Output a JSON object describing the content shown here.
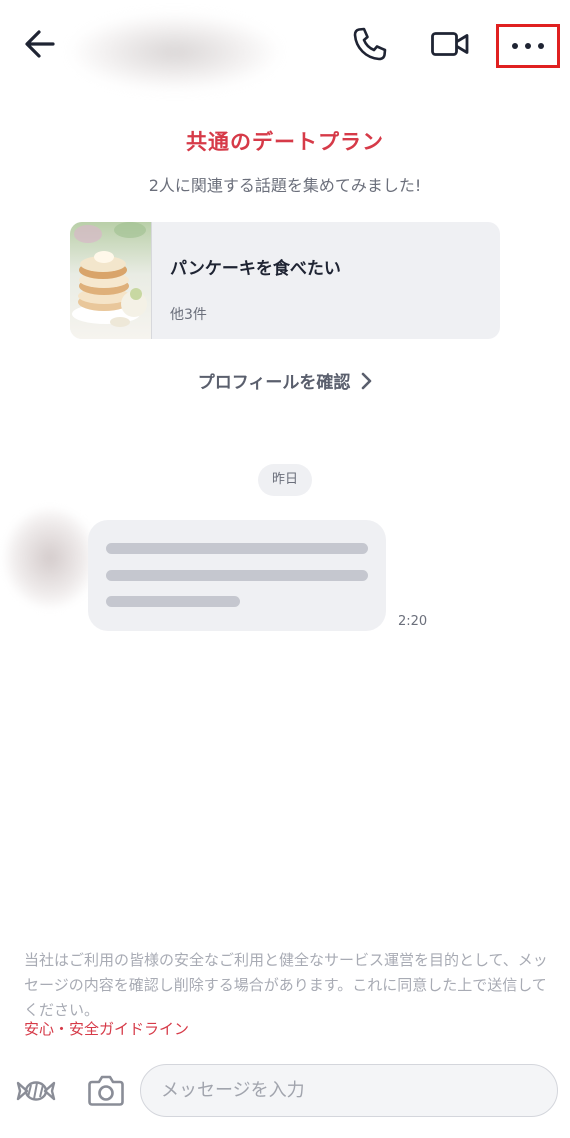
{
  "header": {
    "back_icon": "arrow-left-icon",
    "partner_name": "",
    "call_icon": "phone-icon",
    "video_icon": "video-camera-icon",
    "more_icon": "more-horizontal-icon",
    "highlight_color": "#e02020"
  },
  "date_plan": {
    "title": "共通のデートプラン",
    "subtitle": "2人に関連する話題を集めてみました!",
    "card": {
      "title": "パンケーキを食べたい",
      "count": "他3件",
      "image": "pancake-photo"
    },
    "profile_link": "プロフィールを確認"
  },
  "chat": {
    "date_label": "昨日",
    "messages": [
      {
        "time": "2:20",
        "text_redacted": true
      }
    ]
  },
  "notice": {
    "text": "当社はご利用の皆様の安全なご利用と健全なサービス運営を目的として、メッセージの内容を確認し削除する場合があります。これに同意した上で送信してください。",
    "link": "安心・安全ガイドライン"
  },
  "composer": {
    "candy_icon": "candy-icon",
    "camera_icon": "camera-icon",
    "placeholder": "メッセージを入力"
  },
  "colors": {
    "accent_red": "#d63a48",
    "text_dark": "#1f2433",
    "text_gray": "#6b6f7b",
    "surface_gray": "#eff0f3"
  }
}
